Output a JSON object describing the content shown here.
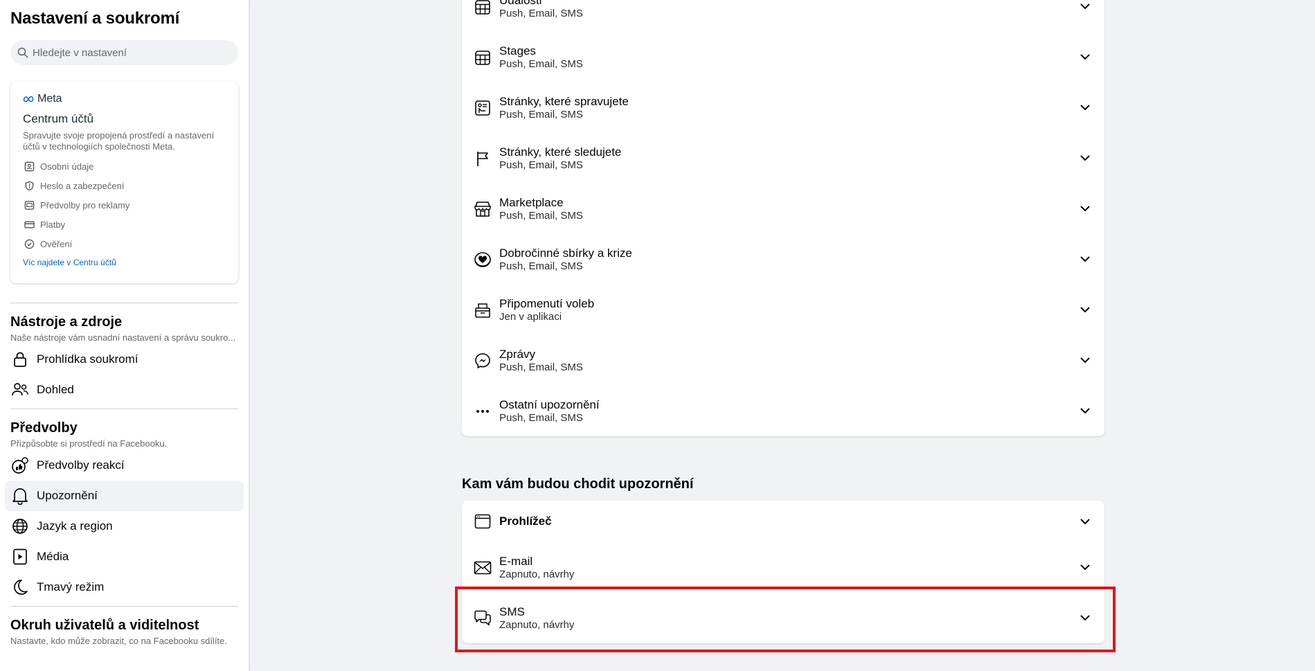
{
  "sidebar": {
    "title": "Nastavení a soukromí",
    "search_placeholder": "Hledejte v nastavení",
    "meta": {
      "logo": "Meta",
      "title": "Centrum účtů",
      "description": "Spravujte svoje propojená prostředí a nastavení účtů v technologiích společnosti Meta.",
      "items": [
        {
          "label": "Osobní údaje",
          "icon": "id-card-icon"
        },
        {
          "label": "Heslo a zabezpečení",
          "icon": "shield-icon"
        },
        {
          "label": "Předvolby pro reklamy",
          "icon": "ad-icon"
        },
        {
          "label": "Platby",
          "icon": "credit-card-icon"
        },
        {
          "label": "Ověření",
          "icon": "check-badge-icon"
        }
      ],
      "link": "Víc najdete v Centru účtů"
    },
    "tools": {
      "title": "Nástroje a zdroje",
      "subtitle": "Naše nástroje vám usnadní nastavení a správu soukro...",
      "items": [
        {
          "label": "Prohlídka soukromí",
          "icon": "lock-icon"
        },
        {
          "label": "Dohled",
          "icon": "people-icon"
        }
      ]
    },
    "prefs": {
      "title": "Předvolby",
      "subtitle": "Přizpůsobte si prostředí na Facebooku.",
      "items": [
        {
          "label": "Předvolby reakcí",
          "icon": "reactions-icon"
        },
        {
          "label": "Upozornění",
          "icon": "bell-icon"
        },
        {
          "label": "Jazyk a region",
          "icon": "globe-icon"
        },
        {
          "label": "Média",
          "icon": "media-icon"
        },
        {
          "label": "Tmavý režim",
          "icon": "moon-icon"
        }
      ]
    },
    "audience": {
      "title": "Okruh uživatelů a viditelnost",
      "subtitle": "Nastavte, kdo může zobrazit, co na Facebooku sdílíte."
    }
  },
  "main": {
    "notifications": [
      {
        "label": "Události",
        "sub": "Push, Email, SMS",
        "icon": "calendar-icon"
      },
      {
        "label": "Stages",
        "sub": "Push, Email, SMS",
        "icon": "calendar-grid-icon"
      },
      {
        "label": "Stránky, které spravujete",
        "sub": "Push, Email, SMS",
        "icon": "managed-page-icon"
      },
      {
        "label": "Stránky, které sledujete",
        "sub": "Push, Email, SMS",
        "icon": "flag-icon"
      },
      {
        "label": "Marketplace",
        "sub": "Push, Email, SMS",
        "icon": "storefront-icon"
      },
      {
        "label": "Dobročinné sbírky a krize",
        "sub": "Push, Email, SMS",
        "icon": "heart-coin-icon"
      },
      {
        "label": "Připomenutí voleb",
        "sub": "Jen v aplikaci",
        "icon": "ballot-box-icon"
      },
      {
        "label": "Zprávy",
        "sub": "Push, Email, SMS",
        "icon": "messenger-icon"
      },
      {
        "label": "Ostatní upozornění",
        "sub": "Push, Email, SMS",
        "icon": "more-icon"
      }
    ],
    "delivery_heading": "Kam vám budou chodit upozornění",
    "delivery": {
      "browser": {
        "label": "Prohlížeč",
        "icon": "browser-icon"
      },
      "email": {
        "label": "E-mail",
        "sub": "Zapnuto, návrhy",
        "icon": "envelope-icon"
      },
      "sms": {
        "label": "SMS",
        "sub": "Zapnuto, návrhy",
        "icon": "chat-bubbles-icon"
      }
    },
    "highlight_color": "#e2151c"
  }
}
